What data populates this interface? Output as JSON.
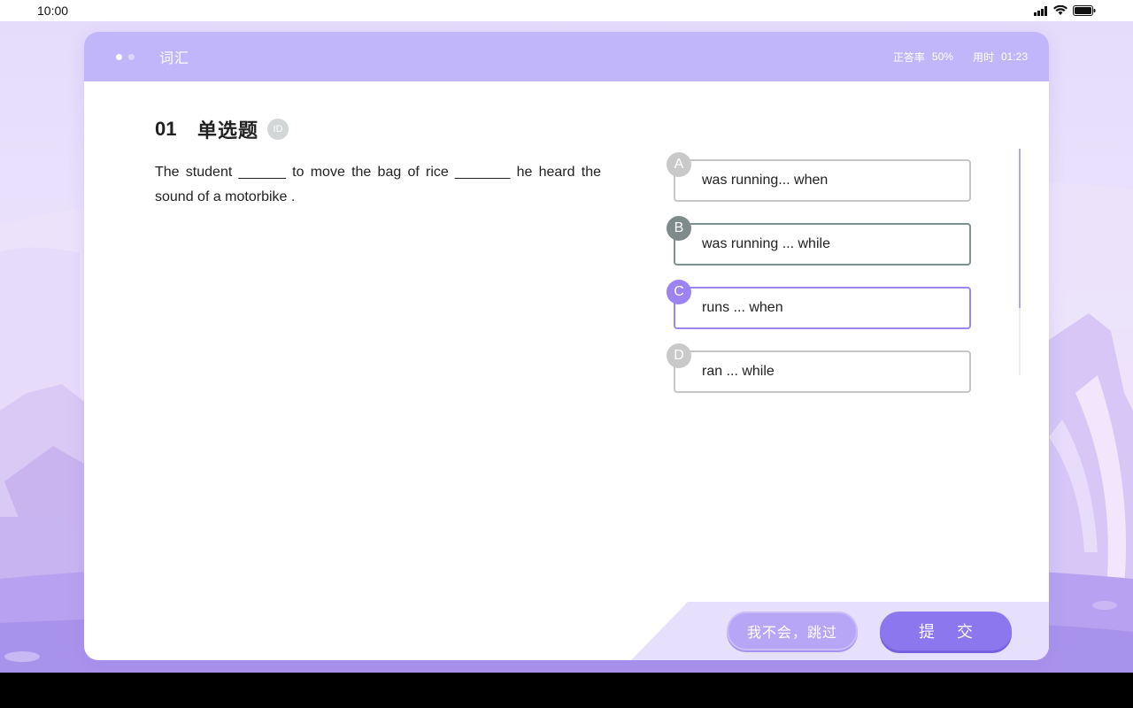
{
  "status_bar": {
    "time": "10:00"
  },
  "header": {
    "title": "词汇",
    "accuracy_label": "正答率",
    "accuracy_value": "50%",
    "time_label": "用时",
    "time_value": "01:23"
  },
  "question": {
    "number": "01",
    "type": "单选题",
    "id_badge": "ID",
    "text": "The student ______ to move the bag of rice _______ he heard the sound of a motorbike ."
  },
  "options": [
    {
      "letter": "A",
      "text": "was running... when"
    },
    {
      "letter": "B",
      "text": "was running ... while"
    },
    {
      "letter": "C",
      "text": "runs ... when"
    },
    {
      "letter": "D",
      "text": "ran ... while"
    }
  ],
  "buttons": {
    "skip": "我不会，跳过",
    "submit": "提 交"
  },
  "colors": {
    "accent": "#8c77ef",
    "header": "#c2b6fa",
    "selected_option": "#9b84f2"
  }
}
